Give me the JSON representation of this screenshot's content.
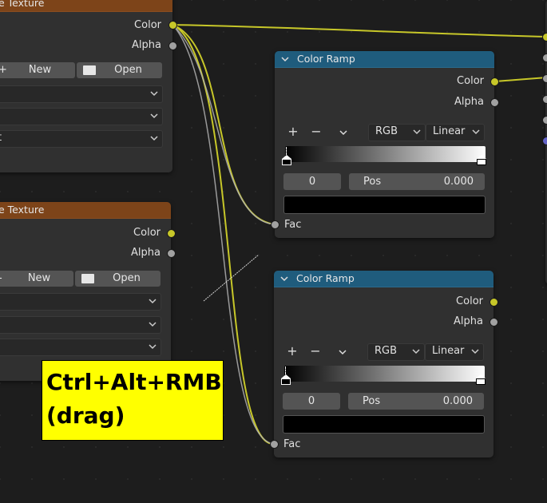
{
  "nodes": {
    "image_texture_1": {
      "title": "e Texture",
      "outputs": {
        "color": "Color",
        "alpha": "Alpha"
      },
      "new_label": "New",
      "open_label": "Open",
      "plus_icon": "+",
      "dropdown3_value": "t"
    },
    "image_texture_2": {
      "title": "e Texture",
      "outputs": {
        "color": "Color",
        "alpha": "Alpha"
      },
      "new_label": "New",
      "open_label": "Open",
      "minus_icon": "-"
    },
    "color_ramp_1": {
      "title": "Color Ramp",
      "outputs": {
        "color": "Color",
        "alpha": "Alpha"
      },
      "add_label": "+",
      "remove_label": "−",
      "color_mode": "RGB",
      "interpolation": "Linear",
      "stop_index": "0",
      "pos_label": "Pos",
      "pos_value": "0.000",
      "input_fac": "Fac"
    },
    "color_ramp_2": {
      "title": "Color Ramp",
      "outputs": {
        "color": "Color",
        "alpha": "Alpha"
      },
      "add_label": "+",
      "remove_label": "−",
      "color_mode": "RGB",
      "interpolation": "Linear",
      "stop_index": "0",
      "pos_label": "Pos",
      "pos_value": "0.000",
      "input_fac": "Fac"
    }
  },
  "overlay": {
    "line1": "Ctrl+Alt+RMB",
    "line2": "(drag)"
  },
  "colors": {
    "socket_color": "#c7c729",
    "socket_float": "#a1a1a1",
    "socket_shader": "#6363c7",
    "texture_header": "#7d4419",
    "converter_header": "#1f5c7d",
    "overlay_bg": "#ffff00"
  }
}
